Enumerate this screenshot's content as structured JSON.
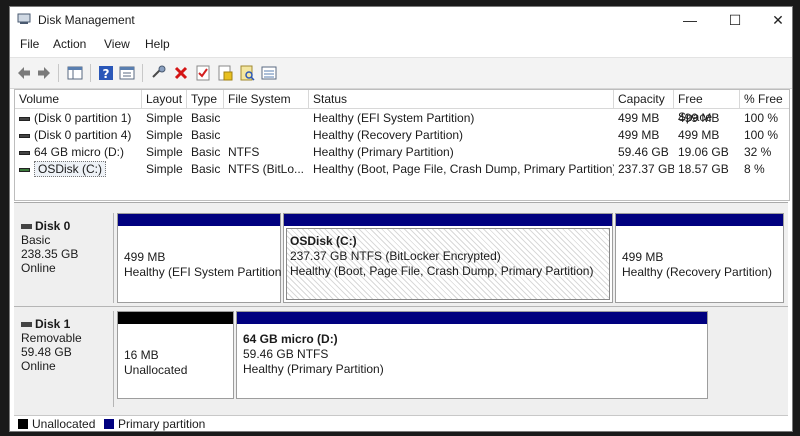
{
  "window": {
    "title": "Disk Management",
    "minimize": "—",
    "maximize": "☐",
    "close": "✕"
  },
  "menu": [
    "File",
    "Action",
    "View",
    "Help"
  ],
  "toolbar": [
    "back-icon",
    "forward-icon",
    "show-hide-console-tree-icon",
    "help-icon",
    "properties-icon",
    "connect-disk-icon",
    "delete-icon",
    "check-icon",
    "new-volume-icon",
    "search-icon",
    "details-view-icon"
  ],
  "volume_list": {
    "columns": [
      "Volume",
      "Layout",
      "Type",
      "File System",
      "Status",
      "Capacity",
      "Free Space",
      "% Free"
    ],
    "rows": [
      [
        "(Disk 0 partition 1)",
        "Simple",
        "Basic",
        "",
        "Healthy (EFI System Partition)",
        "499 MB",
        "499 MB",
        "100 %"
      ],
      [
        "(Disk 0 partition 4)",
        "Simple",
        "Basic",
        "",
        "Healthy (Recovery Partition)",
        "499 MB",
        "499 MB",
        "100 %"
      ],
      [
        "64 GB micro (D:)",
        "Simple",
        "Basic",
        "NTFS",
        "Healthy (Primary Partition)",
        "59.46 GB",
        "19.06 GB",
        "32 %"
      ],
      [
        "OSDisk (C:)",
        "Simple",
        "Basic",
        "NTFS (BitLo...",
        "Healthy (Boot, Page File, Crash Dump, Primary Partition)",
        "237.37 GB",
        "18.57 GB",
        "8 %"
      ]
    ]
  },
  "disks": [
    {
      "name": "Disk 0",
      "type": "Basic",
      "size": "238.35 GB",
      "state": "Online",
      "partitions": [
        {
          "name": "",
          "size": "499 MB",
          "status": "Healthy (EFI System Partition"
        },
        {
          "name": "OSDisk  (C:)",
          "size": "237.37 GB NTFS (BitLocker Encrypted)",
          "status": "Healthy (Boot, Page File, Crash Dump, Primary Partition)"
        },
        {
          "name": "",
          "size": "499 MB",
          "status": "Healthy (Recovery Partition)"
        }
      ]
    },
    {
      "name": "Disk 1",
      "type": "Removable",
      "size": "59.48 GB",
      "state": "Online",
      "partitions": [
        {
          "name": "",
          "size": "16 MB",
          "status": "Unallocated"
        },
        {
          "name": "64 GB micro  (D:)",
          "size": "59.46 GB NTFS",
          "status": "Healthy (Primary Partition)"
        }
      ]
    }
  ],
  "legend": {
    "unallocated": "Unallocated",
    "primary": "Primary partition"
  },
  "colors": {
    "primary": "#00007f",
    "unallocated": "#000000"
  }
}
